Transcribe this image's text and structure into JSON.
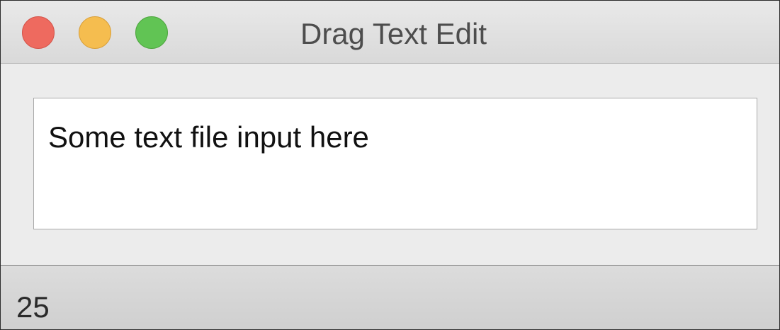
{
  "window": {
    "title": "Drag Text Edit",
    "controls": {
      "close_color": "#ee6a5f",
      "minimize_color": "#f5bd4f",
      "zoom_color": "#61c454"
    }
  },
  "editor": {
    "text": "Some text file input here"
  },
  "status": {
    "value": "25"
  }
}
